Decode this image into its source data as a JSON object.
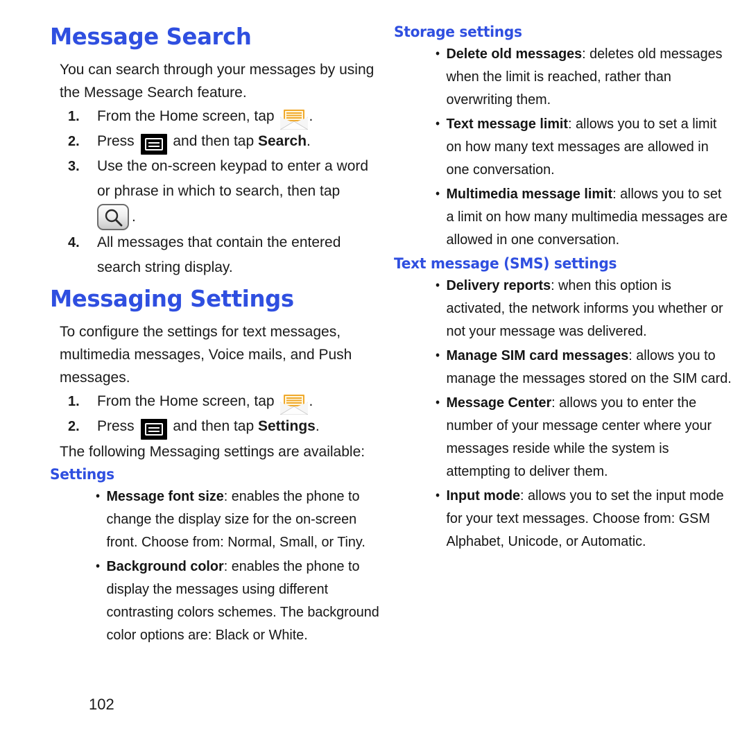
{
  "document": {
    "page_number": "102",
    "heading_color": "#2F4FE0"
  },
  "left_column": {
    "title": "Message Search",
    "intro": "You can search through your messages by using the Message Search feature.",
    "steps": [
      {
        "num": "1.",
        "before_icon": "From the Home screen, tap",
        "icon": "envelope-icon",
        "after_icon": "."
      },
      {
        "num": "2.",
        "before_icon": "Press",
        "icon": "menu-key-icon",
        "mid": "and then tap",
        "bold": "Search",
        "after": "."
      },
      {
        "num": "3.",
        "text": "Use the on-screen keypad to enter a word or phrase in which to search, then tap",
        "icon": "search-button-icon",
        "after": "."
      },
      {
        "num": "4.",
        "text": "All messages that contain the entered search string display."
      }
    ],
    "title2": "Messaging Settings",
    "intro2": "To configure the settings for text messages, multimedia messages, Voice mails, and Push messages.",
    "steps2": [
      {
        "num": "1.",
        "before_icon": "From the Home screen, tap",
        "icon": "envelope-icon",
        "after_icon": "."
      },
      {
        "num": "2.",
        "before_icon": "Press",
        "icon": "menu-key-icon",
        "mid": "and then tap",
        "bold": "Settings",
        "after": "."
      }
    ],
    "available_line": "The following Messaging settings are available:",
    "settings_heading": "Settings",
    "settings_bullets": [
      {
        "term": "Message font size",
        "desc": ": enables the phone to change the display size for the on-screen front. Choose from: Normal, Small, or Tiny."
      },
      {
        "term": "Background color",
        "desc": ": enables the phone to display the messages using different contrasting colors schemes. The background color options are: Black or White."
      }
    ]
  },
  "right_column": {
    "storage_heading": "Storage settings",
    "storage_bullets": [
      {
        "term": "Delete old messages",
        "desc": ": deletes old messages when the limit is reached, rather than overwriting them."
      },
      {
        "term": "Text message limit",
        "desc": ": allows you to set a limit on how many text messages are allowed in one conversation."
      },
      {
        "term": "Multimedia message limit",
        "desc": ": allows you to set a limit on how many multimedia messages are allowed in one conversation."
      }
    ],
    "sms_heading": "Text message (SMS) settings",
    "sms_bullets": [
      {
        "term": "Delivery reports",
        "desc": ": when this option is activated, the network informs you whether or not your message was delivered."
      },
      {
        "term": "Manage SIM card messages",
        "desc": ": allows you to manage the messages stored on the SIM card."
      },
      {
        "term": "Message Center",
        "desc": ": allows you to enter the number of your message center where your messages reside while the system is attempting to deliver them."
      },
      {
        "term": "Input mode",
        "desc": ": allows you to set the input mode for your text messages. Choose from: GSM Alphabet, Unicode, or Automatic."
      }
    ]
  }
}
